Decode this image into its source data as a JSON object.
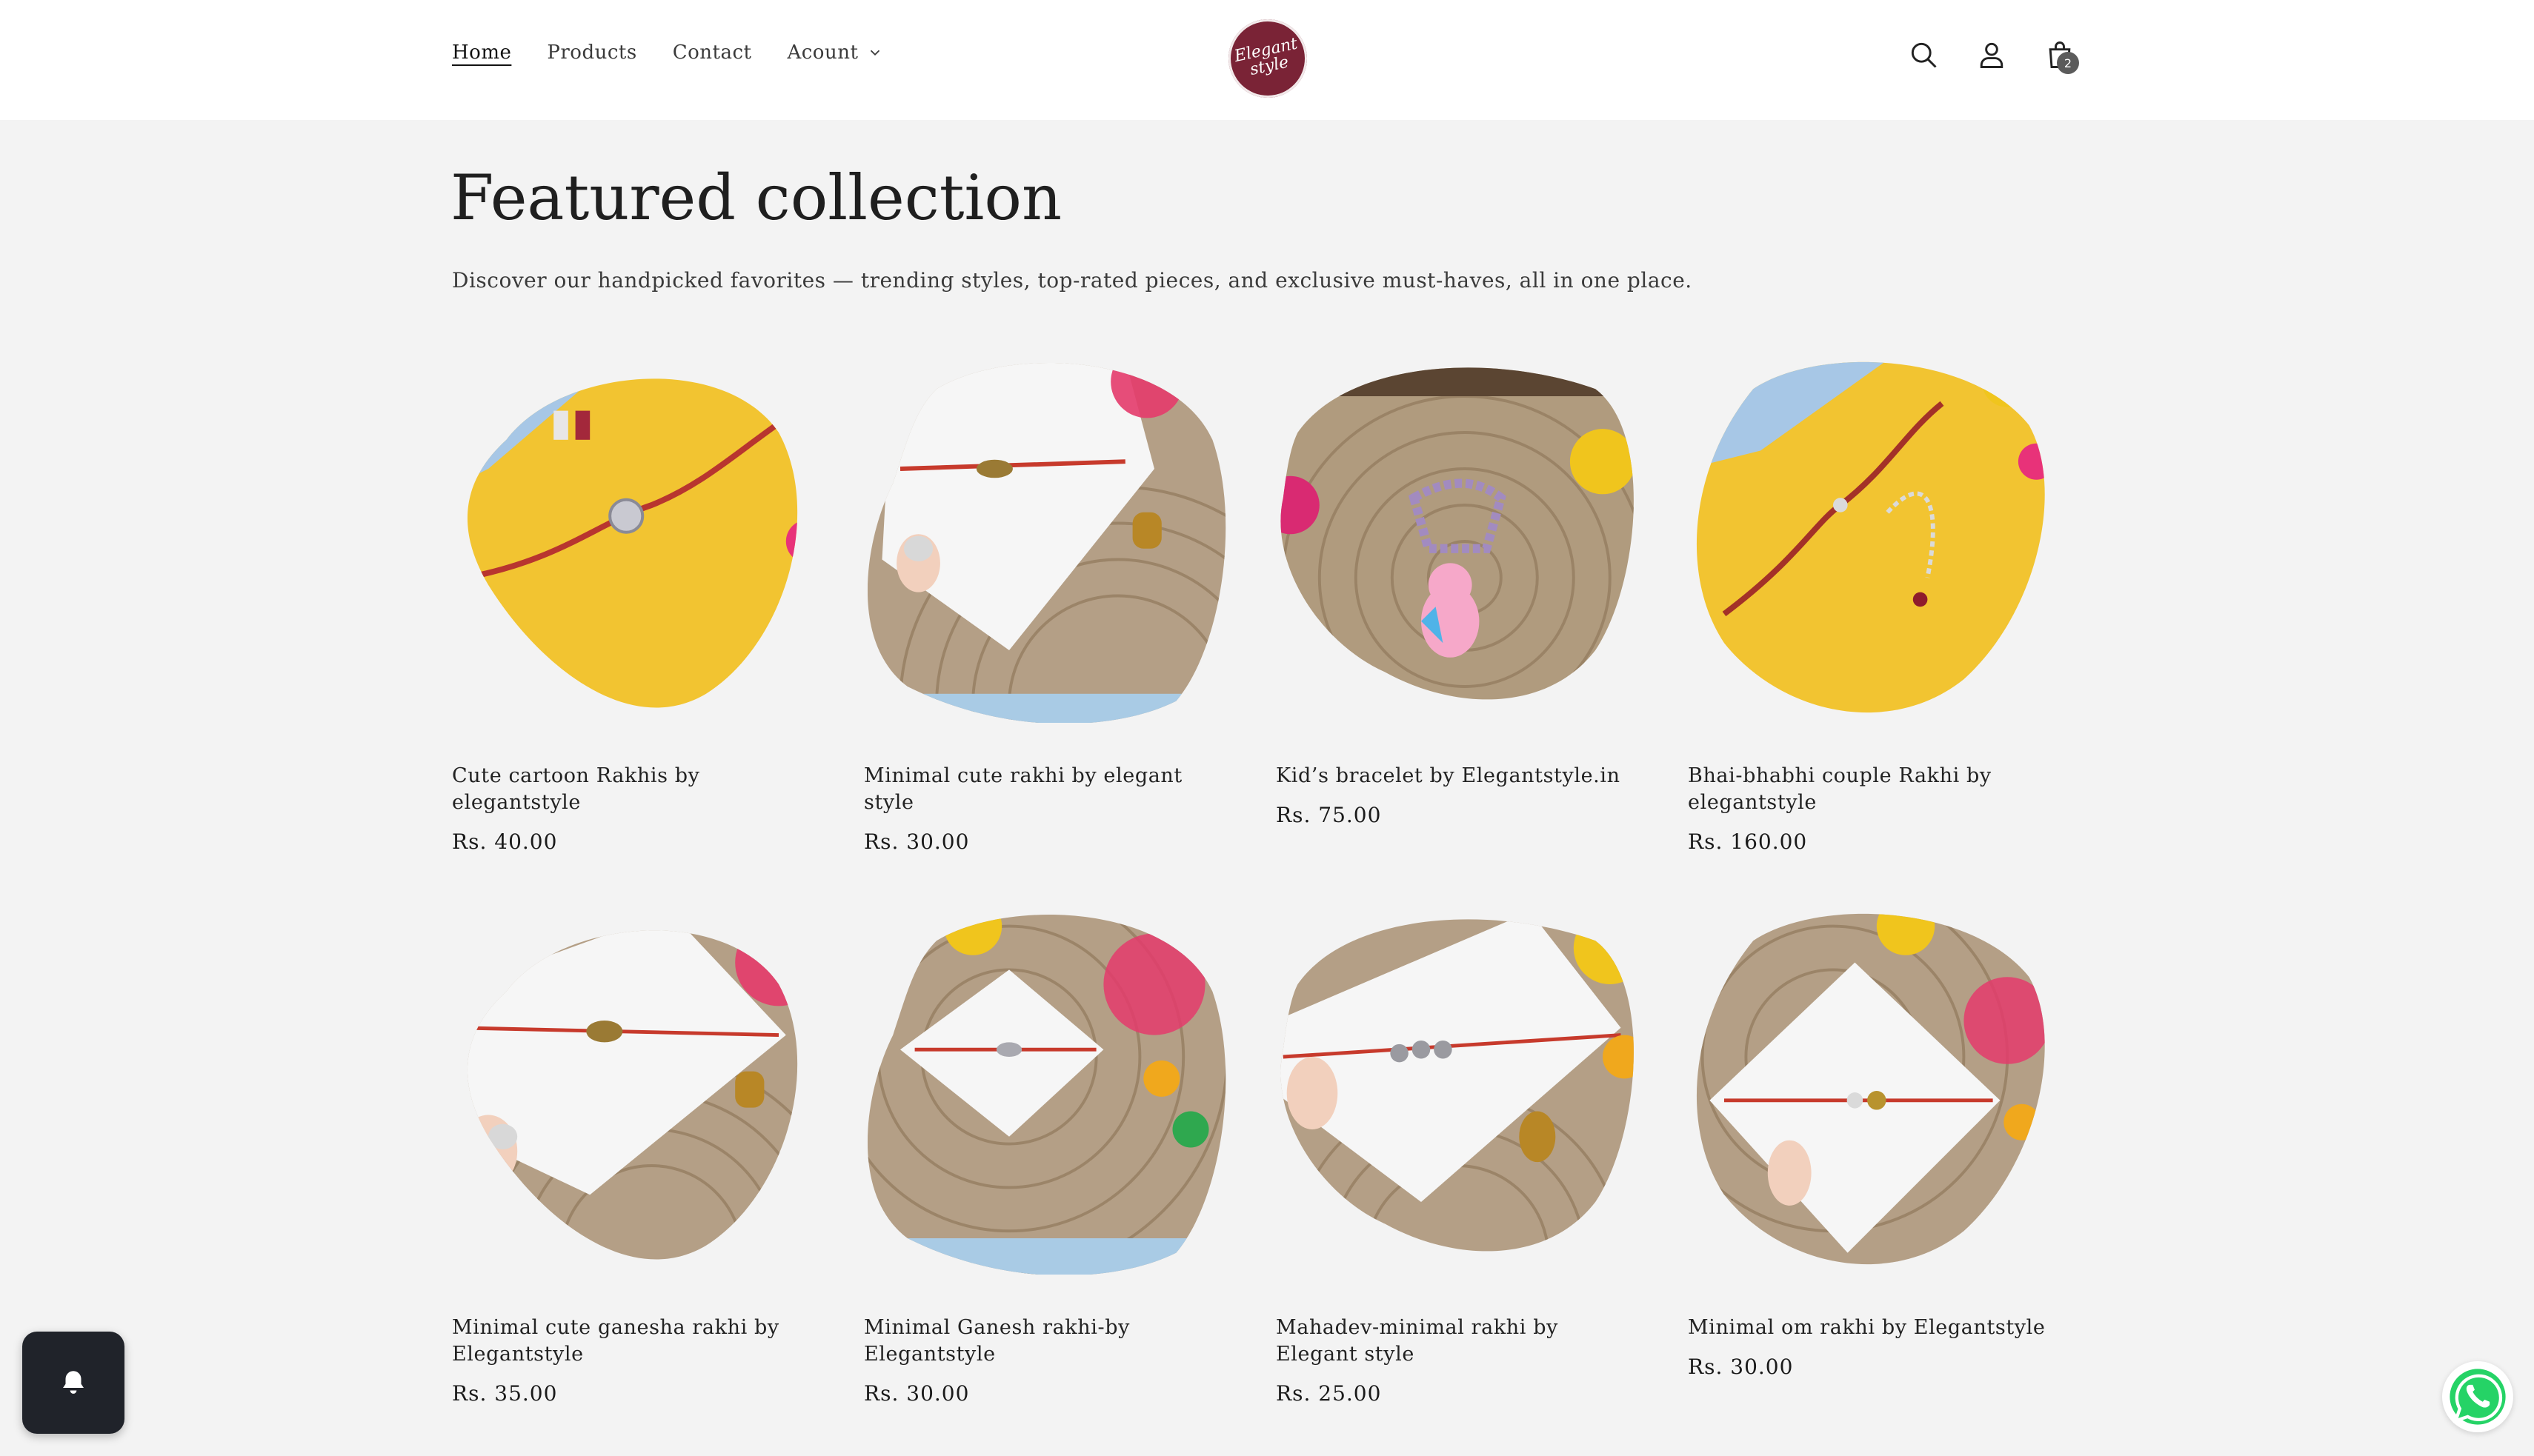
{
  "nav": {
    "items": [
      {
        "label": "Home",
        "active": true
      },
      {
        "label": "Products"
      },
      {
        "label": "Contact"
      },
      {
        "label": "Acount",
        "has_dropdown": true
      }
    ]
  },
  "logo": {
    "line1": "Elegant",
    "line2": "style",
    "color": "#7a2336"
  },
  "header_icons": {
    "search": "search-icon",
    "account": "user-icon",
    "cart": "cart-icon",
    "cart_count": "2"
  },
  "section": {
    "title": "Featured collection",
    "description": "Discover our handpicked favorites — trending styles, top-rated pieces, and exclusive must-haves, all in one place."
  },
  "products": [
    {
      "title": "Cute cartoon Rakhis by elegantstyle",
      "price": "Rs. 40.00"
    },
    {
      "title": "Minimal cute rakhi by elegant style",
      "price": "Rs. 30.00"
    },
    {
      "title": "Kid’s bracelet by Elegantstyle.in",
      "price": "Rs. 75.00"
    },
    {
      "title": "Bhai-bhabhi couple Rakhi by elegantstyle",
      "price": "Rs. 160.00"
    },
    {
      "title": "Minimal cute ganesha rakhi by Elegantstyle",
      "price": "Rs. 35.00"
    },
    {
      "title": "Minimal Ganesh rakhi-by Elegantstyle",
      "price": "Rs. 30.00"
    },
    {
      "title": "Mahadev-minimal rakhi by Elegant style",
      "price": "Rs. 25.00"
    },
    {
      "title": "Minimal om rakhi by Elegantstyle",
      "price": "Rs. 30.00"
    }
  ],
  "widgets": {
    "notification": "bell-icon",
    "chat": "whatsapp-icon",
    "whatsapp_color": "#25d366"
  }
}
